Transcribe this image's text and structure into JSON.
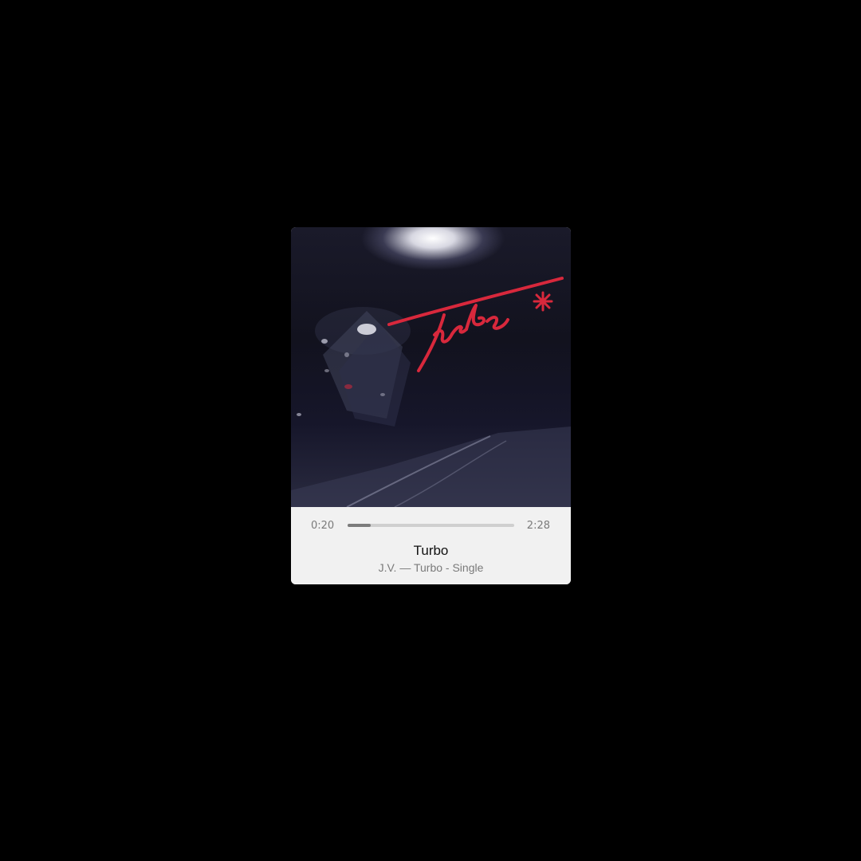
{
  "player": {
    "elapsed": "0:20",
    "duration": "2:28",
    "progress_fraction": 0.14,
    "title": "Turbo",
    "subtitle": "J.V. — Turbo - Single"
  },
  "artwork": {
    "logo_text": "turbo*",
    "logo_color": "#d8283c"
  },
  "colors": {
    "background": "#000000",
    "panel": "#f1f1f1",
    "progress_track": "#cfcfcf",
    "progress_fill": "#7c7c7c"
  }
}
